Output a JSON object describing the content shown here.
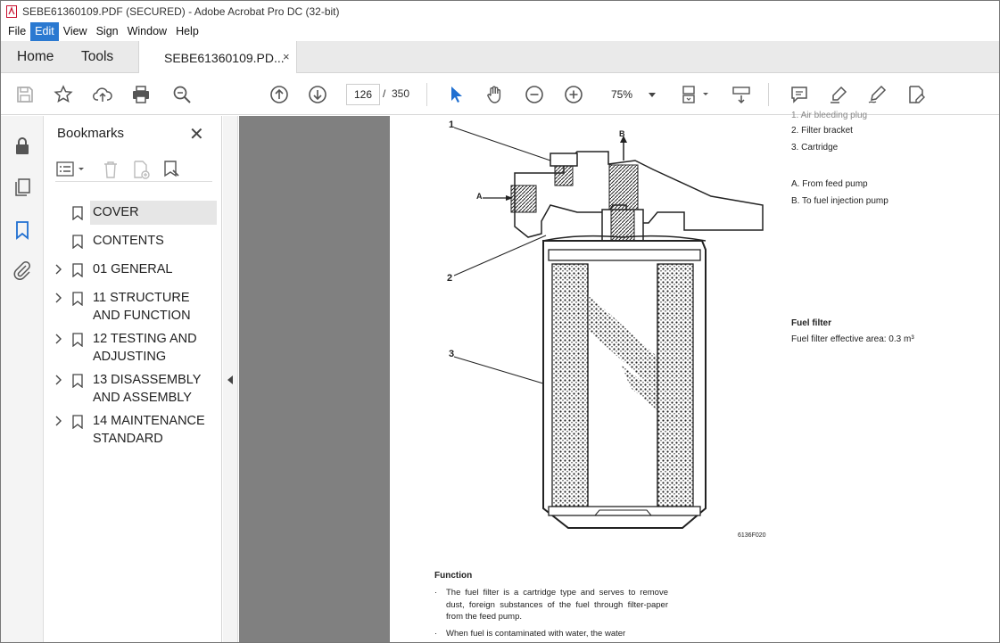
{
  "window": {
    "title": "SEBE61360109.PDF (SECURED) - Adobe Acrobat Pro DC (32-bit)"
  },
  "menu": {
    "items": [
      "File",
      "Edit",
      "View",
      "Sign",
      "Window",
      "Help"
    ],
    "active": "Edit"
  },
  "tabs": {
    "home": "Home",
    "tools": "Tools",
    "document": "SEBE61360109.PD...",
    "close_glyph": "×"
  },
  "toolbar": {
    "current_page": "126",
    "separator": "/",
    "total_pages": "350",
    "zoom": "75%"
  },
  "bookmarks": {
    "title": "Bookmarks",
    "close_glyph": "✕",
    "items": [
      {
        "label": "COVER",
        "expandable": false,
        "selected": true
      },
      {
        "label": "CONTENTS",
        "expandable": false,
        "selected": false
      },
      {
        "label": "01 GENERAL",
        "expandable": true,
        "selected": false
      },
      {
        "label": "11 STRUCTURE AND FUNCTION",
        "expandable": true,
        "selected": false
      },
      {
        "label": "12 TESTING AND ADJUSTING",
        "expandable": true,
        "selected": false
      },
      {
        "label": "13 DISASSEMBLY AND ASSEMBLY",
        "expandable": true,
        "selected": false
      },
      {
        "label": "14 MAINTENANCE STANDARD",
        "expandable": true,
        "selected": false
      }
    ]
  },
  "document": {
    "legend_partial": "1. Air bleeding plug",
    "legend": [
      "2. Filter bracket",
      "3. Cartridge"
    ],
    "flow": [
      "A. From feed pump",
      "B. To fuel injection pump"
    ],
    "caption_title": "Fuel filter",
    "caption_text": "Fuel filter effective area: 0.3 m³",
    "callouts": {
      "c1": "1",
      "c2": "2",
      "c3": "3",
      "a": "A",
      "b": "B"
    },
    "figure_code": "6136F020",
    "function_title": "Function",
    "paragraphs": [
      "The fuel filter is a cartridge type and serves to remove dust, foreign substances of the fuel through filter-paper from the feed pump.",
      "When fuel is contaminated with water, the water"
    ],
    "bullet": "·"
  }
}
